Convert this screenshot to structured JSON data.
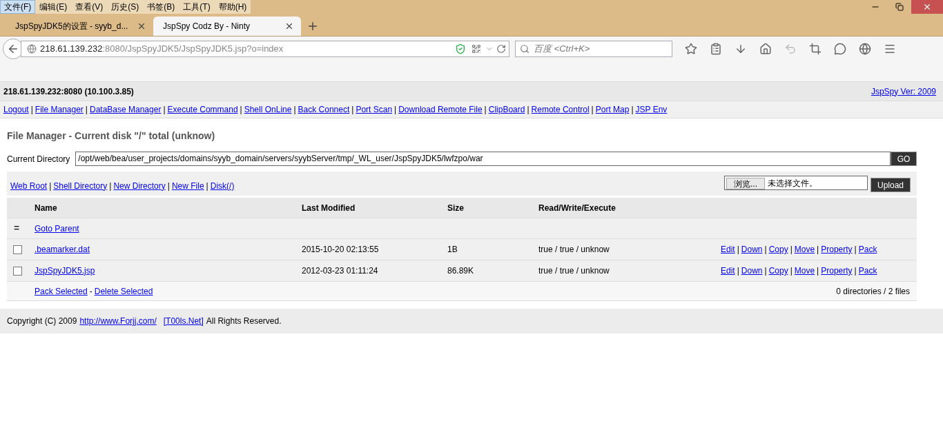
{
  "browser": {
    "menu": [
      {
        "label": "文件(F)",
        "selected": true
      },
      {
        "label": "编辑(E)",
        "selected": false
      },
      {
        "label": "查看(V)",
        "selected": false
      },
      {
        "label": "历史(S)",
        "selected": false
      },
      {
        "label": "书签(B)",
        "selected": false
      },
      {
        "label": "工具(T)",
        "selected": false
      },
      {
        "label": "帮助(H)",
        "selected": false
      }
    ],
    "tabs": [
      {
        "title": "JspSpyJDK5的设置 - syyb_d...",
        "selected": false
      },
      {
        "title": "JspSpy Codz By - Ninty",
        "selected": true
      }
    ],
    "address": {
      "host": "218.61.139.232",
      "rest": ":8080/JspSpyJDK5/JspSpyJDK5.jsp?o=index"
    },
    "search": {
      "placeholder": "百度 <Ctrl+K>"
    }
  },
  "header": {
    "host": "218.61.139.232:8080 (10.100.3.85)",
    "version_link": "JspSpy Ver: 2009"
  },
  "nav": [
    {
      "label": "Logout",
      "sep": "|"
    },
    {
      "label": "File Manager",
      "sep": "|"
    },
    {
      "label": "DataBase Manager",
      "sep": "|"
    },
    {
      "label": "Execute Command",
      "sep": "|"
    },
    {
      "label": "Shell OnLine",
      "sep": "|"
    },
    {
      "label": "Back Connect",
      "sep": "|"
    },
    {
      "label": "Port Scan",
      "sep": "|"
    },
    {
      "label": "Download Remote File",
      "sep": "|"
    },
    {
      "label": "ClipBoard",
      "sep": "|"
    },
    {
      "label": "Remote Control",
      "sep": "|"
    },
    {
      "label": "Port Map",
      "sep": "|"
    },
    {
      "label": "JSP Env"
    }
  ],
  "title": "File Manager - Current disk \"/\" total (unknow)",
  "directory": {
    "label": "Current Directory",
    "value": "/opt/web/bea/user_projects/domains/syyb_domain/servers/syybServer/tmp/_WL_user/JspSpyJDK5/lwfzpo/war",
    "go": "GO"
  },
  "toolbar": {
    "links": [
      {
        "label": "Web Root",
        "sep": "|"
      },
      {
        "label": "Shell Directory",
        "sep": "|"
      },
      {
        "label": "New Directory",
        "sep": "|"
      },
      {
        "label": "New File",
        "sep": "|"
      },
      {
        "label": "Disk(/)"
      }
    ],
    "browse": "浏览...",
    "no_file": "未选择文件。",
    "upload": "Upload"
  },
  "table": {
    "columns": [
      "Name",
      "Last Modified",
      "Size",
      "Read/Write/Execute"
    ],
    "parent": {
      "mark": "=",
      "label": "Goto Parent"
    },
    "rows": [
      {
        "checked": false,
        "name": ".beamarker.dat",
        "modified": "2015-10-20 02:13:55",
        "size": "1B",
        "rwe": "true / true / unknow",
        "actions": [
          {
            "label": "Edit",
            "sep": "|"
          },
          {
            "label": "Down",
            "sep": "|"
          },
          {
            "label": "Copy",
            "sep": "|"
          },
          {
            "label": "Move",
            "sep": "|"
          },
          {
            "label": "Property",
            "sep": "|"
          },
          {
            "label": "Pack"
          }
        ]
      },
      {
        "checked": false,
        "name": "JspSpyJDK5.jsp",
        "modified": "2012-03-23 01:11:24",
        "size": "86.89K",
        "rwe": "true / true / unknow",
        "actions": [
          {
            "label": "Edit",
            "sep": "|"
          },
          {
            "label": "Down",
            "sep": "|"
          },
          {
            "label": "Copy",
            "sep": "|"
          },
          {
            "label": "Move",
            "sep": "|"
          },
          {
            "label": "Property",
            "sep": "|"
          },
          {
            "label": "Pack"
          }
        ]
      }
    ],
    "footer": {
      "pack": "Pack Selected",
      "dash": "-",
      "delete": "Delete Selected",
      "summary": "0 directories / 2 files"
    }
  },
  "footer": {
    "prefix": "Copyright (C) 2009",
    "link1": "http://www.Forjj.com/",
    "link2": "[T00ls.Net]",
    "suffix": "All Rights Reserved."
  }
}
